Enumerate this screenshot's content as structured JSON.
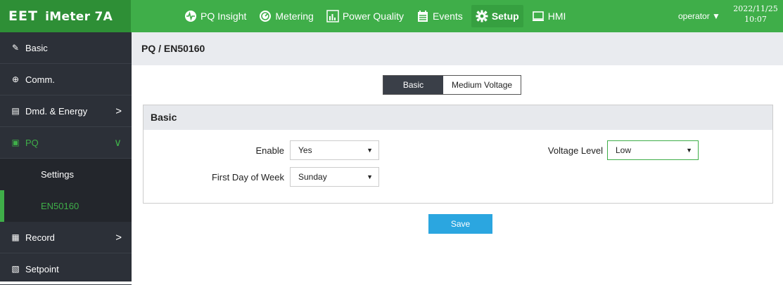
{
  "header": {
    "logo": "EET",
    "product": "iMeter 7A",
    "nav": [
      {
        "label": "PQ Insight",
        "icon": "pq-insight-icon"
      },
      {
        "label": "Metering",
        "icon": "metering-icon"
      },
      {
        "label": "Power Quality",
        "icon": "power-quality-icon"
      },
      {
        "label": "Events",
        "icon": "events-icon"
      },
      {
        "label": "Setup",
        "icon": "gear-icon",
        "active": true
      },
      {
        "label": "HMI",
        "icon": "monitor-icon"
      }
    ],
    "user": "operator",
    "date": "2022/11/25",
    "time": "10:07"
  },
  "sidebar": {
    "items": [
      {
        "label": "Basic",
        "icon": "basic-icon"
      },
      {
        "label": "Comm.",
        "icon": "globe-icon"
      },
      {
        "label": "Dmd. & Energy",
        "icon": "energy-icon",
        "arrow": ">"
      },
      {
        "label": "PQ",
        "icon": "pq-icon",
        "arrow": "∨",
        "expanded": true
      },
      {
        "label": "Settings",
        "sub": true
      },
      {
        "label": "EN50160",
        "sub": true,
        "active": true
      },
      {
        "label": "Record",
        "icon": "record-icon",
        "arrow": ">"
      },
      {
        "label": "Setpoint",
        "icon": "setpoint-icon"
      }
    ]
  },
  "breadcrumb": "PQ / EN50160",
  "tabs": [
    {
      "label": "Basic",
      "active": true
    },
    {
      "label": "Medium Voltage",
      "active": false
    }
  ],
  "panel": {
    "title": "Basic",
    "fields": {
      "enable": {
        "label": "Enable",
        "value": "Yes"
      },
      "voltage_level": {
        "label": "Voltage Level",
        "value": "Low"
      },
      "first_day": {
        "label": "First Day of Week",
        "value": "Sunday"
      }
    }
  },
  "save_label": "Save",
  "colors": {
    "accent": "#3fae49",
    "sidebar": "#2c3038",
    "save": "#2ba6e0"
  }
}
